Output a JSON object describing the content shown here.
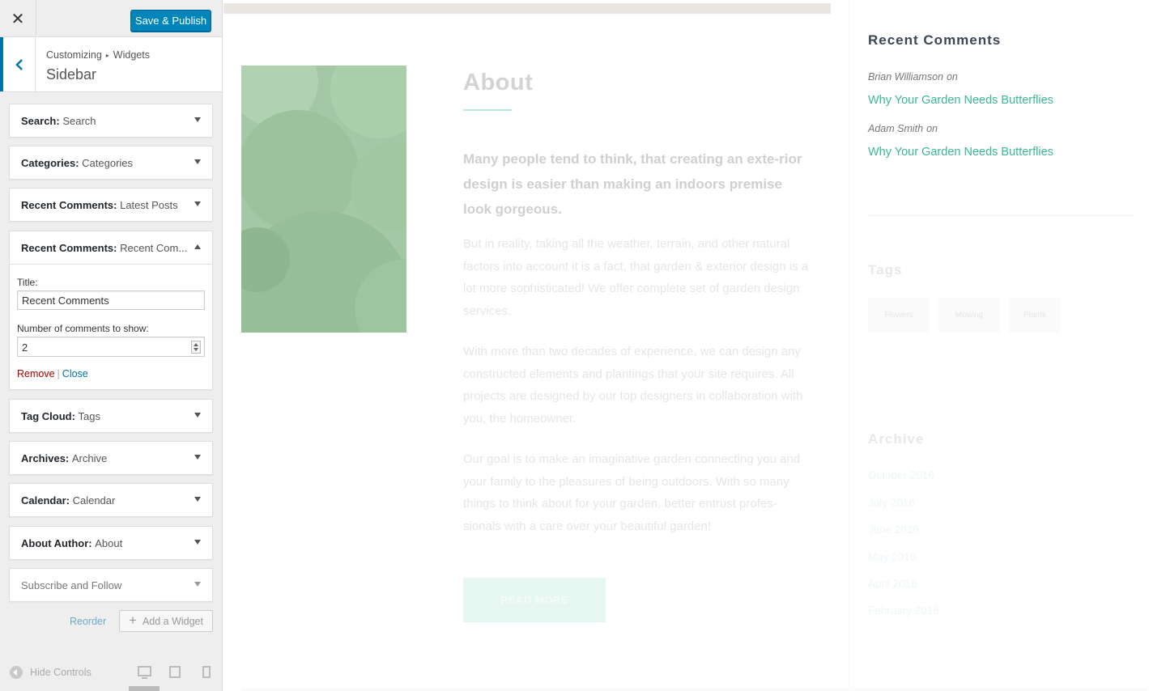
{
  "customizer": {
    "close_glyph": "✕",
    "publish_label": "Save & Publish",
    "breadcrumb": {
      "first": "Customizing",
      "separator": "▸",
      "second": "Widgets"
    },
    "section_name": "Sidebar",
    "widgets": [
      {
        "type": "Search:",
        "title": "Search"
      },
      {
        "type": "Categories:",
        "title": "Categories"
      },
      {
        "type": "Recent Comments:",
        "title": "Latest Posts"
      },
      {
        "type": "Recent Comments:",
        "title": "Recent Com..."
      },
      {
        "type": "Tag Cloud:",
        "title": "Tags"
      },
      {
        "type": "Archives:",
        "title": "Archive"
      },
      {
        "type": "Calendar:",
        "title": "Calendar"
      },
      {
        "type": "About Author:",
        "title": "About"
      },
      {
        "type": "Subscribe and Follow",
        "title": ""
      }
    ],
    "expanded_form": {
      "title_label": "Title:",
      "title_value": "Recent Comments",
      "count_label": "Number of comments to show:",
      "count_value": "2",
      "remove_label": "Remove",
      "divider": "|",
      "close_label": "Close"
    },
    "reorder_label": "Reorder",
    "add_widget_label": "Add a Widget",
    "add_widget_glyph": "+",
    "hide_controls_label": "Hide Controls",
    "devices": [
      "desktop",
      "tablet",
      "mobile"
    ],
    "accent_color": "#0085ba"
  },
  "preview": {
    "about": {
      "title": "About",
      "lead": "Many people tend to think, that creating an exte-rior design is easier than making an indoors premise look gorgeous.",
      "paragraphs": [
        "But in reality, taking all the weather, terrain, and other natural factors into account it is a fact, that garden & exterior design is a lot more sophisticated! We offer complete set of garden design services.",
        "With more than two decades of experience, we can design any constructed elements and plantings that your site requires. All projects are designed by our top designers in collaboration with you, the homeowner.",
        "Our goal is to make an imaginative garden connecting you and your family to the pleasures of being outdoors. With so many things to think about for your garden, better entrust profes-sionals with a care over your beautiful garden!"
      ],
      "button_label": "READ MORE"
    },
    "sidebar": {
      "recent_comments_title": "Recent Comments",
      "comments": [
        {
          "author": "Brian Williamson",
          "on": "on",
          "post": "Why Your Garden Needs Butterflies"
        },
        {
          "author": "Adam Smith",
          "on": "on",
          "post": "Why Your Garden Needs Butterflies"
        }
      ],
      "tags_title": "Tags",
      "tags": [
        "Flowers",
        "Mowing",
        "Plants"
      ],
      "archive_title": "Archive",
      "archive": [
        "October 2016",
        "July 2016",
        "June 2016",
        "May 2016",
        "April 2016",
        "February 2016"
      ],
      "link_color": "#3ab795"
    }
  }
}
